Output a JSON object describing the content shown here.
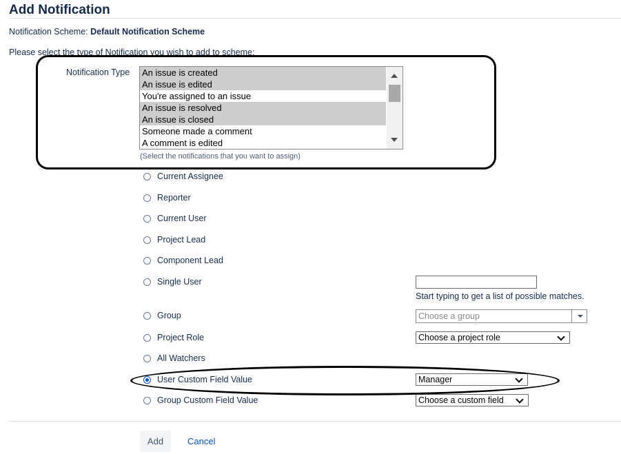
{
  "page": {
    "title": "Add Notification",
    "scheme_label": "Notification Scheme:",
    "scheme_name": "Default Notification Scheme",
    "instructions": "Please select the type of Notification you wish to add to scheme:"
  },
  "notification_type": {
    "label": "Notification Type",
    "help": "(Select the notifications that you want to assign)",
    "options": [
      {
        "label": "An issue is created",
        "selected": true
      },
      {
        "label": "An issue is edited",
        "selected": true
      },
      {
        "label": "You're assigned to an issue",
        "selected": false
      },
      {
        "label": "An issue is resolved",
        "selected": true
      },
      {
        "label": "An issue is closed",
        "selected": true
      },
      {
        "label": "Someone made a comment",
        "selected": false
      },
      {
        "label": "A comment is edited",
        "selected": false
      }
    ]
  },
  "recipients": [
    {
      "label": "Current Assignee",
      "checked": false
    },
    {
      "label": "Reporter",
      "checked": false
    },
    {
      "label": "Current User",
      "checked": false
    },
    {
      "label": "Project Lead",
      "checked": false
    },
    {
      "label": "Component Lead",
      "checked": false
    },
    {
      "label": "Single User",
      "checked": false
    },
    {
      "label": "Group",
      "checked": false
    },
    {
      "label": "Project Role",
      "checked": false
    },
    {
      "label": "All Watchers",
      "checked": false
    },
    {
      "label": "User Custom Field Value",
      "checked": true
    },
    {
      "label": "Group Custom Field Value",
      "checked": false
    }
  ],
  "single_user": {
    "value": "",
    "help": "Start typing to get a list of possible matches."
  },
  "group": {
    "placeholder": "Choose a group"
  },
  "project_role": {
    "selected": "Choose a project role"
  },
  "user_custom_field": {
    "selected": "Manager"
  },
  "group_custom_field": {
    "selected": "Choose a custom field"
  },
  "actions": {
    "add": "Add",
    "cancel": "Cancel"
  }
}
